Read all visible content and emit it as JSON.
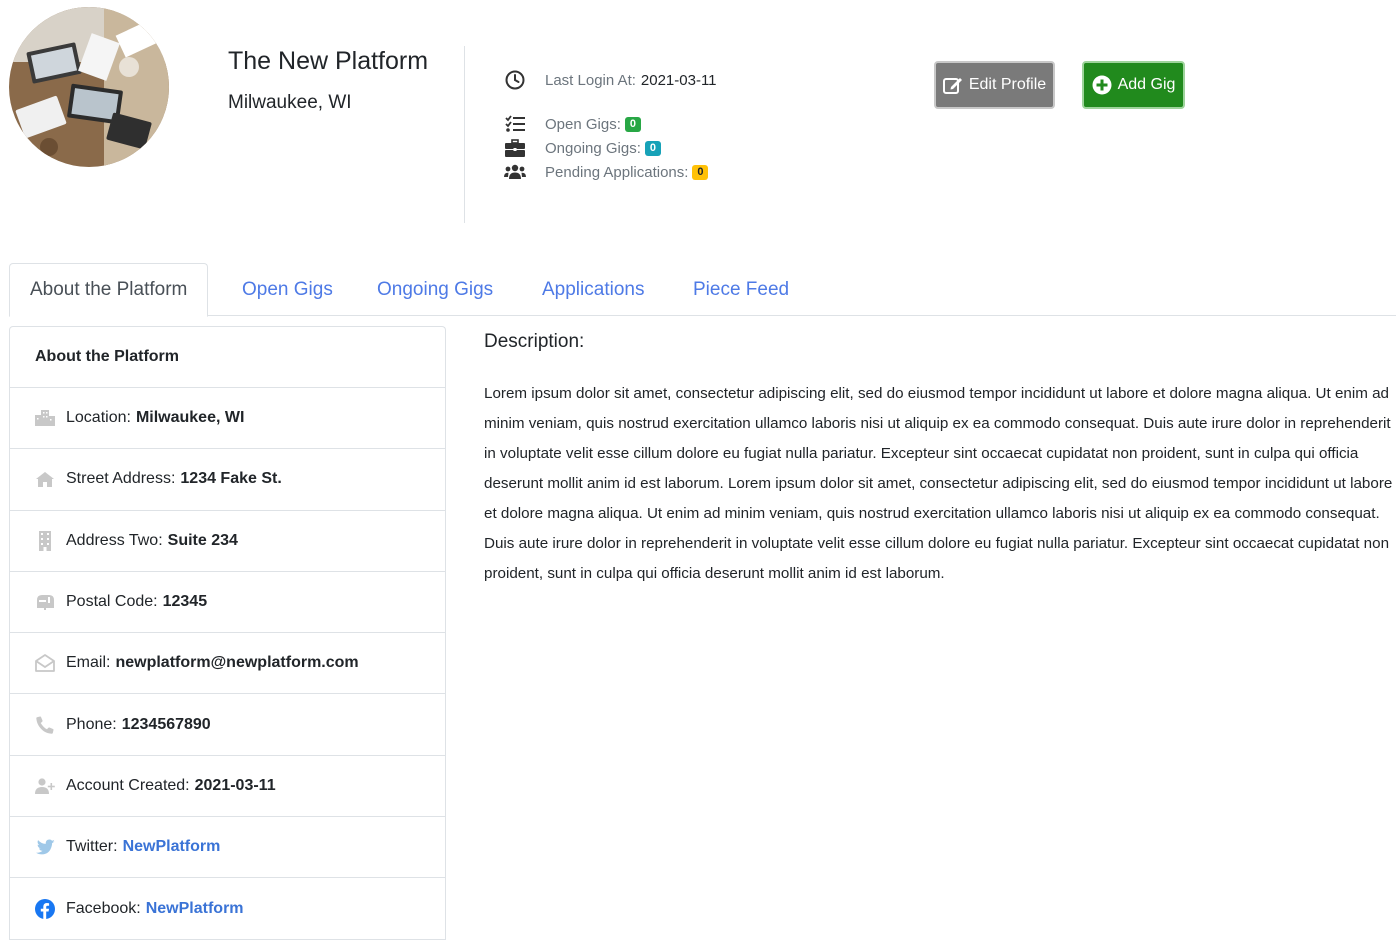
{
  "profile": {
    "name": "The New Platform",
    "location": "Milwaukee, WI",
    "avatar_alt": "team-workspace-photo"
  },
  "stats": {
    "last_login_label": "Last Login At:",
    "last_login_value": "2021-03-11",
    "open_gigs_label": "Open Gigs:",
    "open_gigs_count": "0",
    "ongoing_gigs_label": "Ongoing Gigs:",
    "ongoing_gigs_count": "0",
    "pending_apps_label": "Pending Applications:",
    "pending_apps_count": "0"
  },
  "actions": {
    "edit_profile": "Edit Profile",
    "add_gig": "Add Gig"
  },
  "tabs": [
    {
      "label": "About the Platform",
      "active": true
    },
    {
      "label": "Open Gigs",
      "active": false
    },
    {
      "label": "Ongoing Gigs",
      "active": false
    },
    {
      "label": "Applications",
      "active": false
    },
    {
      "label": "Piece Feed",
      "active": false
    }
  ],
  "about": {
    "header": "About the Platform",
    "rows": [
      {
        "icon": "city-icon",
        "label": "Location:",
        "value": "Milwaukee, WI"
      },
      {
        "icon": "home-icon",
        "label": "Street Address:",
        "value": "1234 Fake St."
      },
      {
        "icon": "building-icon",
        "label": "Address Two:",
        "value": "Suite 234"
      },
      {
        "icon": "mailbox-icon",
        "label": "Postal Code:",
        "value": "12345"
      },
      {
        "icon": "envelope-open-icon",
        "label": "Email:",
        "value": "newplatform@newplatform.com"
      },
      {
        "icon": "phone-icon",
        "label": "Phone:",
        "value": "1234567890"
      },
      {
        "icon": "user-plus-icon",
        "label": "Account Created:",
        "value": "2021-03-11"
      },
      {
        "icon": "twitter-icon",
        "label": "Twitter:",
        "value": "NewPlatform"
      },
      {
        "icon": "facebook-icon",
        "label": "Facebook:",
        "value": "NewPlatform"
      }
    ]
  },
  "description": {
    "title": "Description:",
    "body": "Lorem ipsum dolor sit amet, consectetur adipiscing elit, sed do eiusmod tempor incididunt ut labore et dolore magna aliqua. Ut enim ad minim veniam, quis nostrud exercitation ullamco laboris nisi ut aliquip ex ea commodo consequat. Duis aute irure dolor in reprehenderit in voluptate velit esse cillum dolore eu fugiat nulla pariatur. Excepteur sint occaecat cupidatat non proident, sunt in culpa qui officia deserunt mollit anim id est laborum. Lorem ipsum dolor sit amet, consectetur adipiscing elit, sed do eiusmod tempor incididunt ut labore et dolore magna aliqua. Ut enim ad minim veniam, quis nostrud exercitation ullamco laboris nisi ut aliquip ex ea commodo consequat. Duis aute irure dolor in reprehenderit in voluptate velit esse cillum dolore eu fugiat nulla pariatur. Excepteur sint occaecat cupidatat non proident, sunt in culpa qui officia deserunt mollit anim id est laborum."
  },
  "colors": {
    "link": "#4e7ae6",
    "edit_button": "#7a7a7a",
    "add_button": "#218a1d",
    "badge_green": "#28a745",
    "badge_teal": "#17a2b8",
    "badge_yellow": "#ffc107",
    "twitter": "#1da1f2",
    "facebook": "#1877f2"
  }
}
